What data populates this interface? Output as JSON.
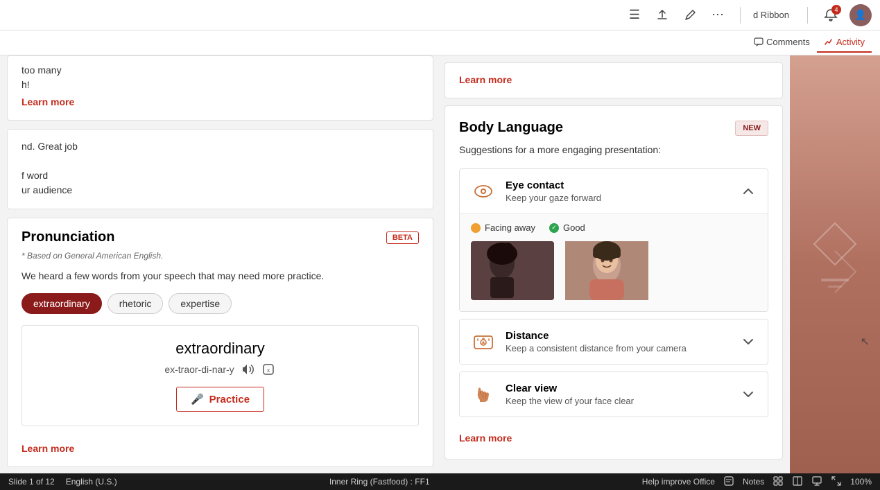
{
  "topbar": {
    "hamburger_icon": "☰",
    "share_icon": "⬆",
    "edit_icon": "✎",
    "more_icon": "⋯",
    "ribbon_label": "d Ribbon",
    "notification_count": "4",
    "comments_label": "Comments",
    "activity_label": "Activity"
  },
  "left_panel": {
    "clipped_text_1": "too many",
    "clipped_text_2": "h!",
    "clipped_text_3": "nd. Great job",
    "clipped_text_4": "f word",
    "clipped_text_5": "ur audience",
    "learn_more_top": "Learn more",
    "pronunciation": {
      "title": "Pronunciation",
      "badge": "BETA",
      "based_on": "* Based on General American English.",
      "description": "We heard a few words from your speech that may need more practice.",
      "chips": [
        "extraordinary",
        "rhetoric",
        "expertise"
      ],
      "selected_chip": "extraordinary",
      "word_detail": {
        "word": "extraordinary",
        "phonetic": "ex-traor-di-nar-y",
        "audio_icon": "🔊",
        "slow_icon": "⏸",
        "practice_label": "Practice",
        "mic_icon": "🎤"
      },
      "learn_more": "Learn more"
    }
  },
  "right_panel": {
    "top_learn_more": "Learn more",
    "body_language": {
      "title": "Body Language",
      "badge": "NEW",
      "subtitle": "Suggestions for a more engaging presentation:",
      "sections": [
        {
          "id": "eye-contact",
          "icon": "👁",
          "name": "Eye contact",
          "desc": "Keep your gaze forward",
          "expanded": true,
          "toggle": "^",
          "statuses": [
            {
              "label": "Facing away",
              "type": "warning"
            },
            {
              "label": "Good",
              "type": "good"
            }
          ],
          "images": [
            "facing-away",
            "good"
          ]
        },
        {
          "id": "distance",
          "icon": "📷",
          "name": "Distance",
          "desc": "Keep a consistent distance from your camera",
          "expanded": false,
          "toggle": "v"
        },
        {
          "id": "clear-view",
          "icon": "👋",
          "name": "Clear view",
          "desc": "Keep the view of your face clear",
          "expanded": false,
          "toggle": "v"
        }
      ],
      "learn_more": "Learn more"
    }
  },
  "statusbar": {
    "slide_info": "Slide 1 of 12",
    "language": "English (U.S.)",
    "center": "Inner Ring (Fastfood) : FF1",
    "help": "Help improve Office",
    "notes": "Notes",
    "zoom": "100%"
  }
}
